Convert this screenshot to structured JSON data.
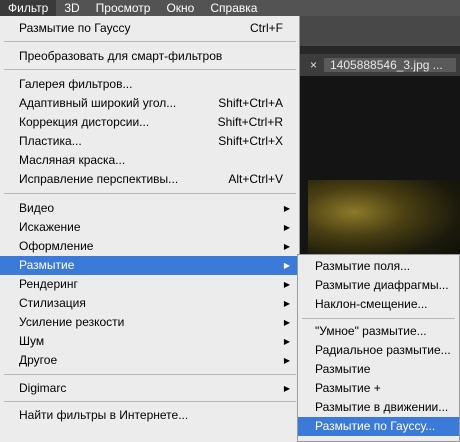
{
  "menubar": {
    "items": [
      "Фильтр",
      "3D",
      "Просмотр",
      "Окно",
      "Справка"
    ]
  },
  "document_tab": {
    "close": "×",
    "title": "1405888546_3.jpg ...",
    "title_close": "×"
  },
  "filter_menu": {
    "last_filter": {
      "label": "Размытие по Гауссу",
      "shortcut": "Ctrl+F"
    },
    "convert": {
      "label": "Преобразовать для смарт-фильтров"
    },
    "gallery": {
      "label": "Галерея фильтров..."
    },
    "adaptive_wide": {
      "label": "Адаптивный широкий угол...",
      "shortcut": "Shift+Ctrl+A"
    },
    "lens_correction": {
      "label": "Коррекция дисторсии...",
      "shortcut": "Shift+Ctrl+R"
    },
    "liquify": {
      "label": "Пластика...",
      "shortcut": "Shift+Ctrl+X"
    },
    "oil_paint": {
      "label": "Масляная краска..."
    },
    "vanishing_point": {
      "label": "Исправление перспективы...",
      "shortcut": "Alt+Ctrl+V"
    },
    "video": {
      "label": "Видео"
    },
    "distort": {
      "label": "Искажение"
    },
    "stylize_design": {
      "label": "Оформление"
    },
    "blur": {
      "label": "Размытие"
    },
    "render": {
      "label": "Рендеринг"
    },
    "stylize": {
      "label": "Стилизация"
    },
    "sharpen": {
      "label": "Усиление резкости"
    },
    "noise": {
      "label": "Шум"
    },
    "other": {
      "label": "Другое"
    },
    "digimarc": {
      "label": "Digimarc"
    },
    "find_online": {
      "label": "Найти фильтры в Интернете..."
    }
  },
  "blur_submenu": {
    "items": [
      "Размытие поля...",
      "Размытие диафрагмы...",
      "Наклон-смещение...",
      "\"Умное\" размытие...",
      "Радиальное размытие...",
      "Размытие",
      "Размытие +",
      "Размытие в движении...",
      "Размытие по Гауссу..."
    ]
  },
  "colors": {
    "highlight": "#3b7ad9",
    "menu_bg": "#ececec",
    "menubar_bg": "#535353"
  }
}
